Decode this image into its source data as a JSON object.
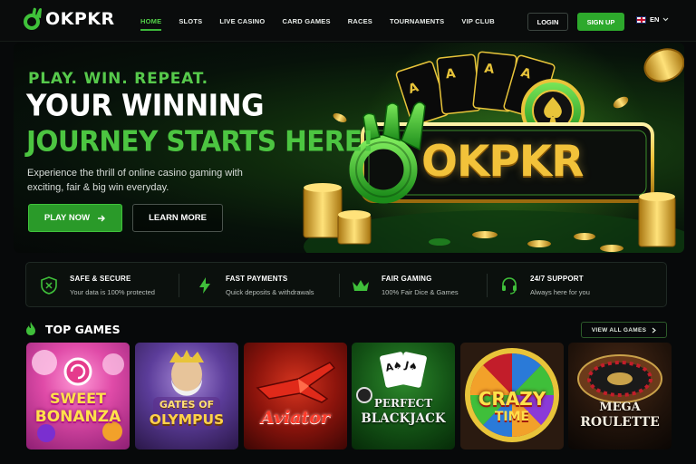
{
  "brand": {
    "name": "OKPKR",
    "accent": "#3cb83a",
    "gold": "#e8c43a"
  },
  "nav": {
    "links": [
      "HOME",
      "SLOTS",
      "LIVE CASINO",
      "CARD GAMES",
      "RACES",
      "TOURNAMENTS",
      "VIP CLUB"
    ],
    "active": "HOME",
    "login_label": "LOGIN",
    "signup_label": "SIGN UP",
    "language": "EN",
    "language_flag": "uk-flag-icon"
  },
  "hero": {
    "eyebrow": "PLAY. WIN. REPEAT.",
    "headline_line1": "YOUR WINNING",
    "headline_line2": "JOURNEY STARTS HERE!",
    "description": "Experience the thrill of online casino gaming with exciting, fair & big win everyday.",
    "play_label": "PLAY NOW",
    "learn_label": "LEARN MORE",
    "art_logo_text": "OKPKR"
  },
  "features": [
    {
      "icon": "shield-check-icon",
      "title": "SAFE & SECURE",
      "subtitle": "Your data is 100% protected"
    },
    {
      "icon": "lightning-icon",
      "title": "FAST PAYMENTS",
      "subtitle": "Quick deposits & withdrawals"
    },
    {
      "icon": "crown-icon",
      "title": "FAIR GAMING",
      "subtitle": "100% Fair Dice & Games"
    },
    {
      "icon": "headset-icon",
      "title": "24/7 SUPPORT",
      "subtitle": "Always here for you"
    }
  ],
  "top_games": {
    "title": "TOP GAMES",
    "view_all_label": "VIEW ALL GAMES",
    "games": [
      {
        "line1": "SWEET",
        "line2": "BONANZA"
      },
      {
        "line1": "GATES OF",
        "line2": "OLYMPUS"
      },
      {
        "line1": "Aviator",
        "line2": ""
      },
      {
        "line1": "PERFECT",
        "line2": "BLACKJACK"
      },
      {
        "line1": "CRAZY",
        "line2": "TIME"
      },
      {
        "line1": "MEGA",
        "line2": "ROULETTE"
      }
    ]
  }
}
